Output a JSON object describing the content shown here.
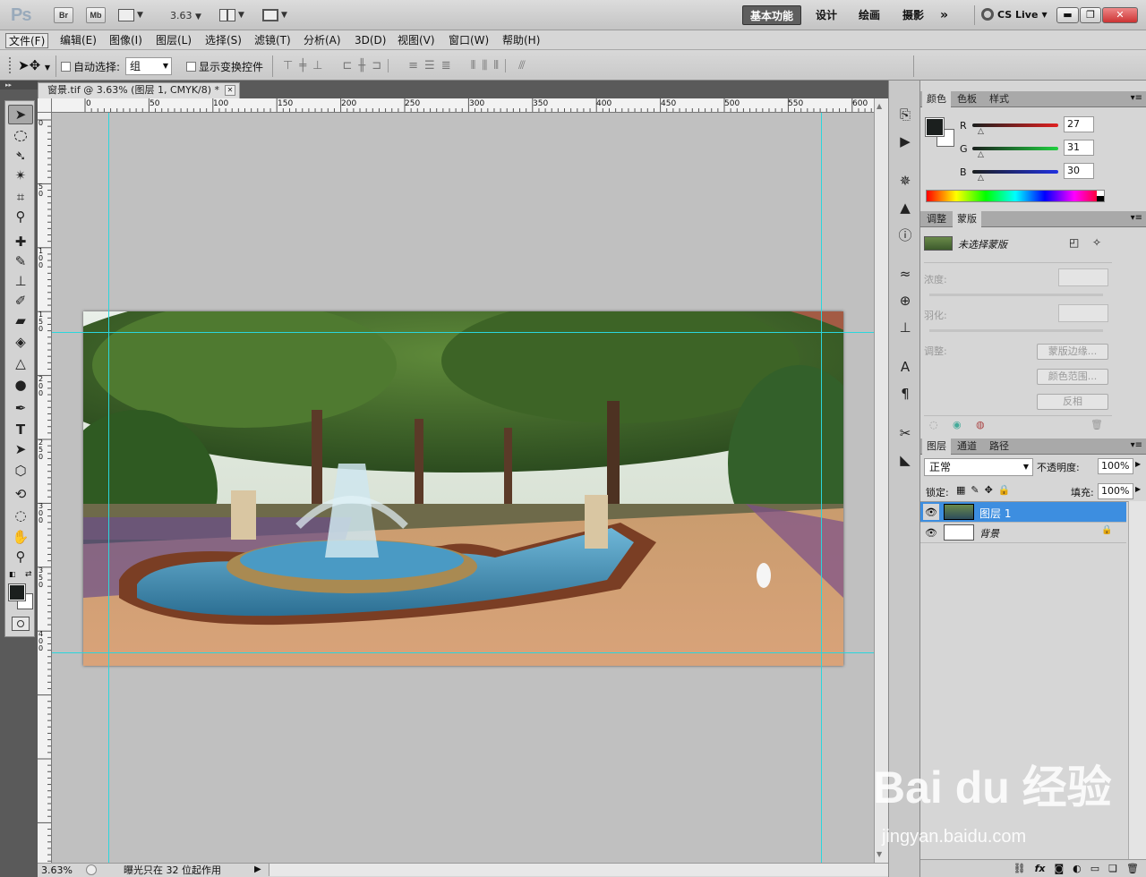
{
  "app": {
    "logo": "Ps",
    "bridge": "Br",
    "mini_bridge": "Mb",
    "zoom_value": "3.63"
  },
  "workspaces": [
    "基本功能",
    "设计",
    "绘画",
    "摄影",
    "»"
  ],
  "cs_live": "CS Live",
  "menu": [
    "文件(F)",
    "编辑(E)",
    "图像(I)",
    "图层(L)",
    "选择(S)",
    "滤镜(T)",
    "分析(A)",
    "3D(D)",
    "视图(V)",
    "窗口(W)",
    "帮助(H)"
  ],
  "options": {
    "auto_select_label": "自动选择:",
    "auto_select_value": "组",
    "transform_controls_label": "显示变换控件"
  },
  "document": {
    "tab_title": "窗景.tif @ 3.63% (图层 1, CMYK/8) *",
    "close": "✕"
  },
  "ruler_h": [
    "0",
    "50",
    "100",
    "150",
    "200",
    "250",
    "300",
    "350",
    "400",
    "450",
    "500",
    "550",
    "600"
  ],
  "ruler_v": [
    "0",
    "50",
    "100",
    "150",
    "200",
    "250",
    "300",
    "350",
    "400"
  ],
  "status": {
    "zoom": "3.63%",
    "message": "曝光只在 32 位起作用"
  },
  "color_panel": {
    "tabs": [
      "颜色",
      "色板",
      "样式"
    ],
    "r_label": "R",
    "g_label": "G",
    "b_label": "B",
    "r": "27",
    "g": "31",
    "b": "30",
    "foreground": "#1b1f1e"
  },
  "masks_panel": {
    "tabs": [
      "调整",
      "蒙版"
    ],
    "no_mask": "未选择蒙版",
    "density": "浓度:",
    "feather": "羽化:",
    "refine": "调整:",
    "btn_mask_edge": "蒙版边缘...",
    "btn_color_range": "颜色范围...",
    "btn_invert": "反相"
  },
  "layers_panel": {
    "tabs": [
      "图层",
      "通道",
      "路径"
    ],
    "blend_mode": "正常",
    "opacity_label": "不透明度:",
    "opacity": "100%",
    "lock_label": "锁定:",
    "fill_label": "填充:",
    "fill": "100%",
    "layers": [
      {
        "name": "图层 1",
        "selected": true
      },
      {
        "name": "背景",
        "selected": false,
        "locked": true
      }
    ]
  },
  "watermark": {
    "brand": "Bai du 经验",
    "url": "jingyan.baidu.com"
  }
}
